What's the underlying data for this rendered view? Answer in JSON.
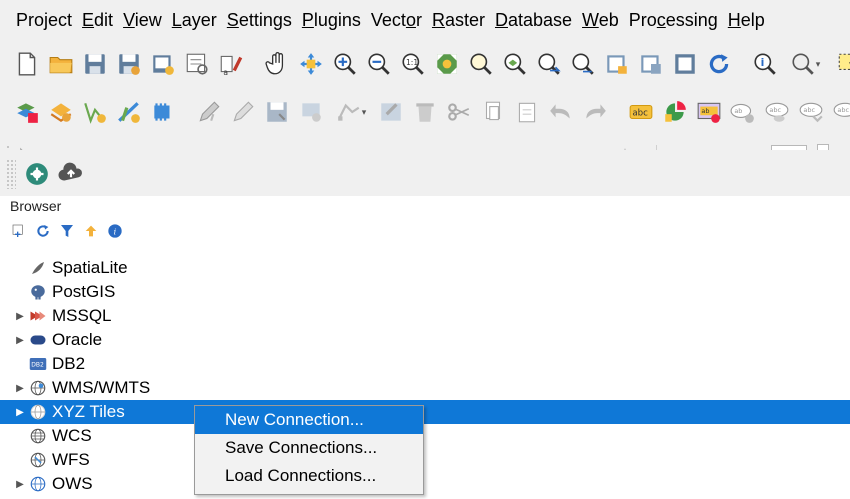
{
  "menu": [
    {
      "pre": "",
      "u": "",
      "post": "Project"
    },
    {
      "pre": "",
      "u": "E",
      "post": "dit"
    },
    {
      "pre": "",
      "u": "V",
      "post": "iew"
    },
    {
      "pre": "",
      "u": "L",
      "post": "ayer"
    },
    {
      "pre": "",
      "u": "S",
      "post": "ettings"
    },
    {
      "pre": "",
      "u": "P",
      "post": "lugins"
    },
    {
      "pre": "Vect",
      "u": "o",
      "post": "r"
    },
    {
      "pre": "",
      "u": "R",
      "post": "aster"
    },
    {
      "pre": "",
      "u": "D",
      "post": "atabase"
    },
    {
      "pre": "",
      "u": "W",
      "post": "eb"
    },
    {
      "pre": "Pro",
      "u": "c",
      "post": "essing"
    },
    {
      "pre": "",
      "u": "H",
      "post": "elp"
    }
  ],
  "toolbar3": {
    "font_size_value": "12",
    "unit_label": "px"
  },
  "browser": {
    "title": "Browser",
    "items": [
      {
        "label": "SpatiaLite",
        "expandable": false,
        "icon": "feather-icon"
      },
      {
        "label": "PostGIS",
        "expandable": false,
        "icon": "elephant-icon"
      },
      {
        "label": "MSSQL",
        "expandable": true,
        "icon": "mssql-icon"
      },
      {
        "label": "Oracle",
        "expandable": true,
        "icon": "oracle-icon"
      },
      {
        "label": "DB2",
        "expandable": false,
        "icon": "db2-icon"
      },
      {
        "label": "WMS/WMTS",
        "expandable": true,
        "icon": "globe-icon"
      },
      {
        "label": "XYZ Tiles",
        "expandable": true,
        "icon": "globe-icon",
        "selected": true
      },
      {
        "label": "WCS",
        "expandable": false,
        "icon": "globe-icon"
      },
      {
        "label": "WFS",
        "expandable": false,
        "icon": "globe-icon"
      },
      {
        "label": "OWS",
        "expandable": true,
        "icon": "globe-icon"
      }
    ]
  },
  "context_menu": {
    "items": [
      "New Connection...",
      "Save Connections...",
      "Load Connections..."
    ]
  }
}
